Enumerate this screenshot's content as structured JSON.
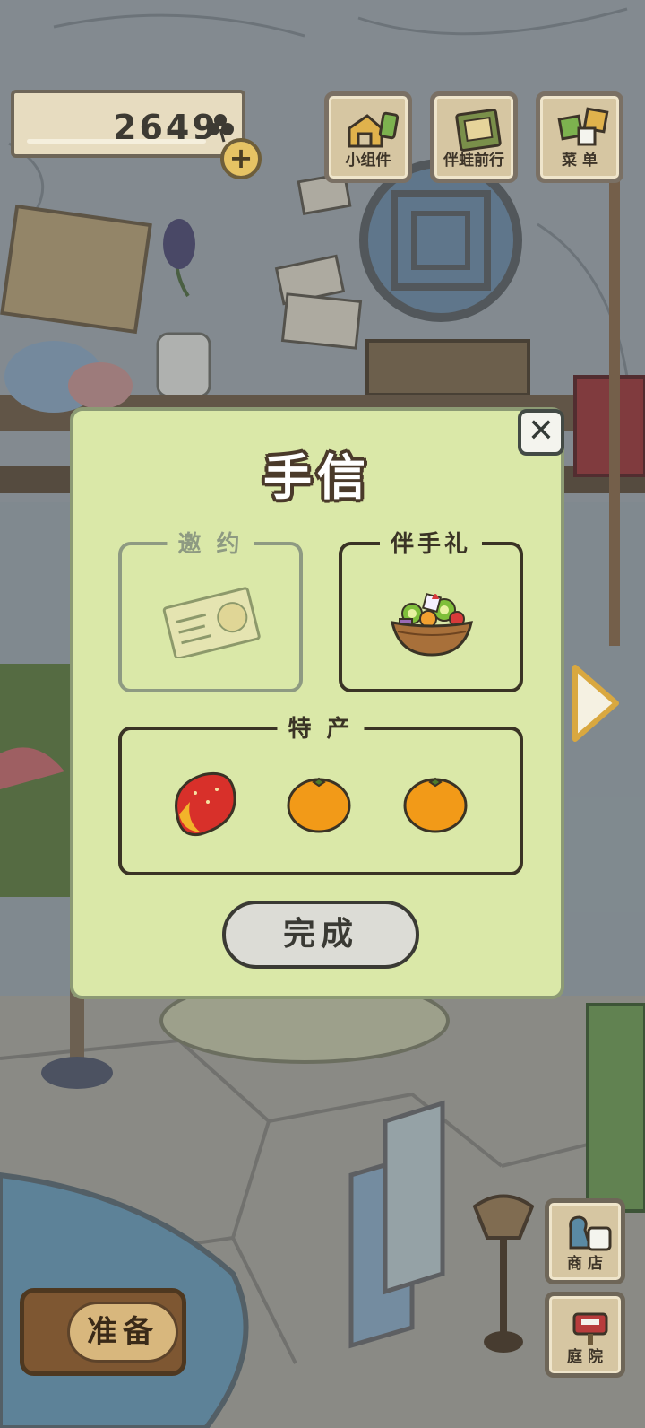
{
  "clovers": {
    "count": "2649",
    "add_symbol": "+"
  },
  "top_menu": [
    {
      "label": "小组件",
      "icon": "widget-icon"
    },
    {
      "label": "伴蛙前行",
      "icon": "journey-book-icon"
    },
    {
      "label": "菜 单",
      "icon": "menu-tiles-icon"
    }
  ],
  "modal": {
    "title": "手信",
    "close_symbol": "✕",
    "invitation_label": "邀 约",
    "gift_label": "伴手礼",
    "specialty_label": "特 产",
    "done_label": "完成",
    "items": {
      "invitation": "invitation-card-icon",
      "gift": "fruit-bowl-icon",
      "specialty": [
        "mango-icon",
        "orange-icon",
        "orange-icon"
      ]
    }
  },
  "side_menu": [
    {
      "label": "商 店",
      "icon": "shop-bags-icon"
    },
    {
      "label": "庭 院",
      "icon": "mailbox-icon"
    }
  ],
  "prepare": {
    "label": "准备"
  },
  "colors": {
    "modal_bg": "#dae8a8",
    "outline": "#3a3325",
    "clover_button": "#e6c364"
  }
}
